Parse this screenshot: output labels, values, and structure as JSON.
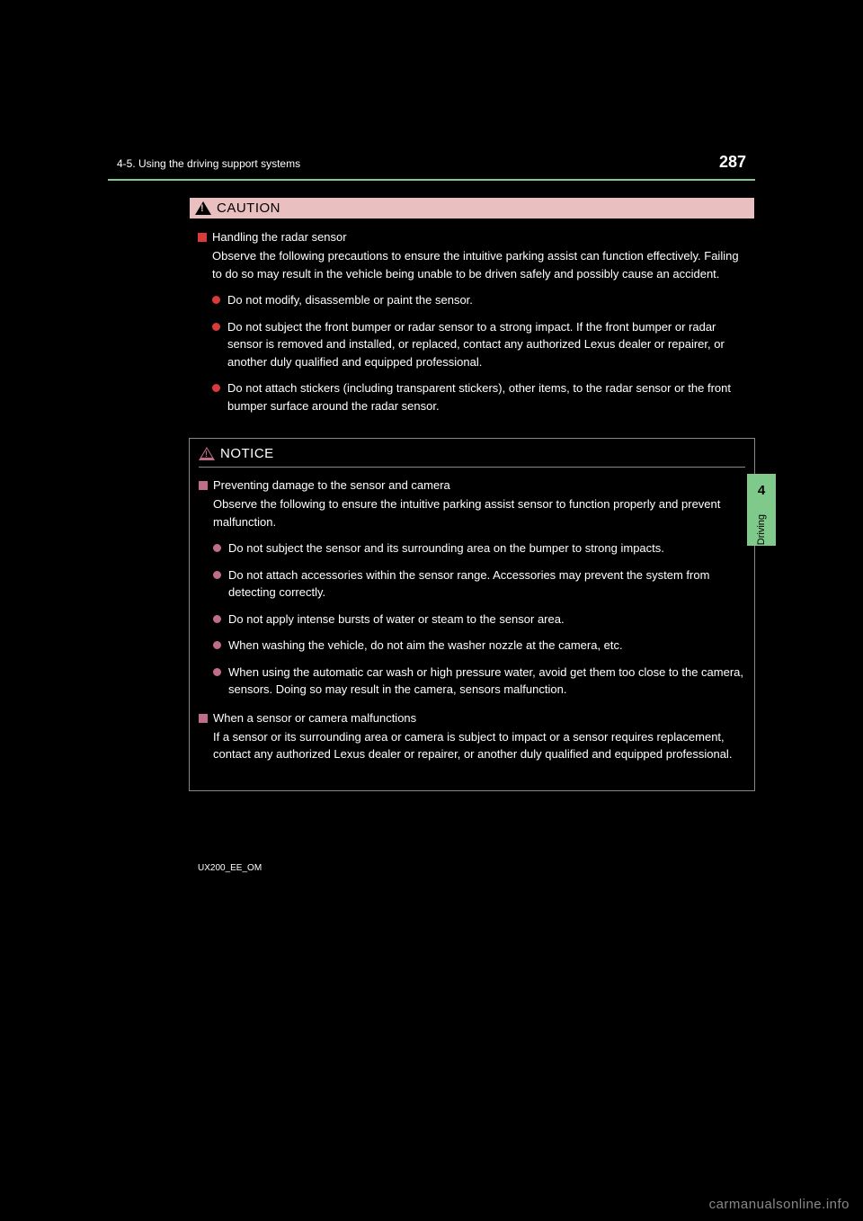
{
  "header": {
    "page_number": "287",
    "section": "4-5. Using the driving support systems"
  },
  "side_tab": {
    "number": "4",
    "label": "Driving"
  },
  "caution": {
    "label": "CAUTION",
    "section1": {
      "title": "Handling the radar sensor",
      "intro": "Observe the following precautions to ensure the intuitive parking assist can function effectively.\nFailing to do so may result in the vehicle being unable to be driven safely and possibly cause an accident.",
      "bullets": [
        "Do not modify, disassemble or paint the sensor.",
        "Do not subject the front bumper or radar sensor to a strong impact.\nIf the front bumper or radar sensor is removed and installed, or replaced, contact any authorized Lexus dealer or repairer, or another duly qualified and equipped professional.",
        "Do not attach stickers (including transparent stickers), other items, to the radar sensor or the front bumper surface around the radar sensor."
      ]
    }
  },
  "notice": {
    "label": "NOTICE",
    "section1": {
      "title": "Preventing damage to the sensor and camera",
      "intro": "Observe the following to ensure the intuitive parking assist sensor to function properly and prevent malfunction.",
      "bullets": [
        "Do not subject the sensor and its surrounding area on the bumper to strong impacts.",
        "Do not attach accessories within the sensor range. Accessories may prevent the system from detecting correctly.",
        "Do not apply intense bursts of water or steam to the sensor area.",
        "When washing the vehicle, do not aim the washer nozzle at the camera, etc.",
        "When using the automatic car wash or high pressure water, avoid get them too close to the camera, sensors. Doing so may result in the camera, sensors malfunction."
      ]
    },
    "section2": {
      "title": "When a sensor or camera malfunctions",
      "body": "If a sensor or its surrounding area or camera is subject to impact or a sensor requires replacement, contact any authorized Lexus dealer or repairer, or another duly qualified and equipped professional."
    }
  },
  "footer_code": "UX200_EE_OM",
  "watermark": "carmanualsonline.info"
}
